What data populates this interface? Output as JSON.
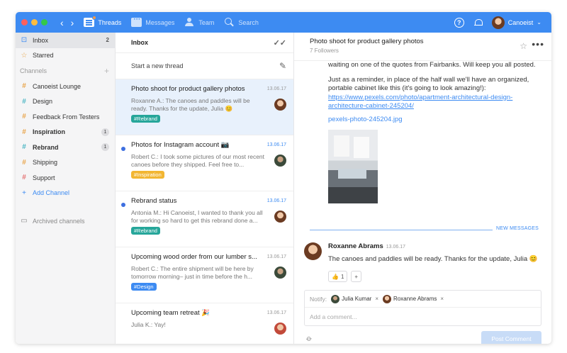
{
  "topbar": {
    "tabs": [
      {
        "label": "Threads",
        "icon": "threads-icon"
      },
      {
        "label": "Messages",
        "icon": "messages-icon"
      },
      {
        "label": "Team",
        "icon": "team-icon"
      },
      {
        "label": "Search",
        "icon": "search-icon"
      }
    ],
    "username": "Canoeist",
    "accent": "#3d8bf2"
  },
  "sidebar": {
    "inbox": {
      "label": "Inbox",
      "count": "2"
    },
    "starred": {
      "label": "Starred"
    },
    "channels_header": "Channels",
    "channels": [
      {
        "label": "Canoeist Lounge",
        "color": "#e8a54b",
        "bold": false,
        "count": ""
      },
      {
        "label": "Design",
        "color": "#4db6c4",
        "bold": false,
        "count": ""
      },
      {
        "label": "Feedback From Testers",
        "color": "#e8a54b",
        "bold": false,
        "count": ""
      },
      {
        "label": "Inspiration",
        "color": "#e8a54b",
        "bold": true,
        "count": "1"
      },
      {
        "label": "Rebrand",
        "color": "#4db6c4",
        "bold": true,
        "count": "1"
      },
      {
        "label": "Shipping",
        "color": "#e8a54b",
        "bold": false,
        "count": ""
      },
      {
        "label": "Support",
        "color": "#e57373",
        "bold": false,
        "count": ""
      }
    ],
    "add_channel": "Add Channel",
    "archived": "Archived channels"
  },
  "threads": {
    "header": "Inbox",
    "new_thread": "Start a new thread",
    "items": [
      {
        "title": "Photo shoot for product gallery photos",
        "date": "13.06.17",
        "preview": "Roxanne A.: The canoes and paddles will be ready. Thanks for the update, Julia 😊",
        "tag": "#Rebrand",
        "tag_color": "#26a69a",
        "unread": false,
        "selected": true
      },
      {
        "title": "Photos for Instagram account 📷",
        "date": "13.06.17",
        "preview": "Robert C.: I took some pictures of our most recent canoes before they shipped. Feel free to...",
        "tag": "#Inspiration",
        "tag_color": "#f2b632",
        "unread": true,
        "selected": false
      },
      {
        "title": "Rebrand status",
        "date": "13.06.17",
        "preview": "Antonia M.: Hi Canoeist, I wanted to thank you all for working so hard to get this rebrand done a...",
        "tag": "#Rebrand",
        "tag_color": "#26a69a",
        "unread": true,
        "selected": false
      },
      {
        "title": "Upcoming wood order from our lumber s...",
        "date": "13.06.17",
        "preview": "Robert C.: The entire shipment will be here by tomorrow morning– just in time before the h...",
        "tag": "#Design",
        "tag_color": "#3d8bf2",
        "unread": false,
        "selected": false
      },
      {
        "title": "Upcoming team retreat 🎉",
        "date": "13.06.17",
        "preview": "Julia K.: Yay!",
        "tag": "",
        "tag_color": "",
        "unread": false,
        "selected": false
      }
    ]
  },
  "conversation": {
    "title": "Photo shoot for product gallery photos",
    "followers": "7 Followers",
    "body_text_1": "waiting on one of the quotes from Fairbanks. Will keep you all posted.",
    "body_text_2": "Just as a reminder, in place of the half wall we'll have an organized, portable cabinet like this (it's going to look amazing!): ",
    "body_link": "https://www.pexels.com/photo/apartment-architectural-design-architecture-cabinet-245204/",
    "file_name": "pexels-photo-245204.jpg",
    "new_messages": "NEW MESSAGES",
    "message": {
      "author": "Roxanne Abrams",
      "time": "13.06.17",
      "text": "The canoes and paddles will be ready. Thanks for the update, Julia 😊",
      "reaction_count": "1"
    },
    "compose": {
      "notify_label": "Notify:",
      "notify_people": [
        "Julia Kumar",
        "Roxanne Abrams"
      ],
      "placeholder": "Add a comment...",
      "post_label": "Post Comment"
    }
  }
}
